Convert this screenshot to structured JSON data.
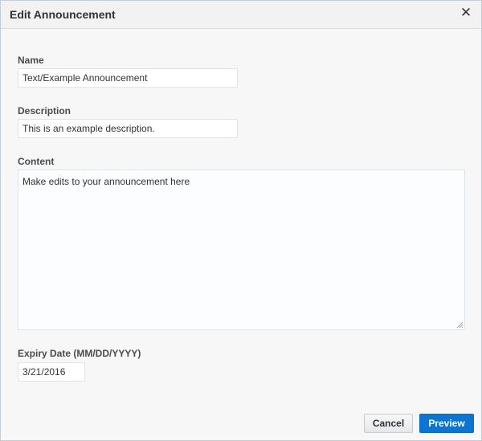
{
  "dialog": {
    "title": "Edit Announcement",
    "close_glyph": "✕",
    "close_icon": "close-icon"
  },
  "form": {
    "name": {
      "label": "Name",
      "value": "Text/Example Announcement"
    },
    "description": {
      "label": "Description",
      "value": "This is an example description."
    },
    "content": {
      "label": "Content",
      "value": "Make edits to your announcement here",
      "resize_icon": "resize-grip-icon"
    },
    "expiry": {
      "label": "Expiry Date (MM/DD/YYYY)",
      "value": "3/21/2016"
    }
  },
  "footer": {
    "cancel_label": "Cancel",
    "preview_label": "Preview"
  },
  "colors": {
    "primary": "#0c75d2",
    "dialog_bg": "#f7f7f7",
    "header_bg": "#f2f2f2",
    "border": "#dfe4e8"
  }
}
